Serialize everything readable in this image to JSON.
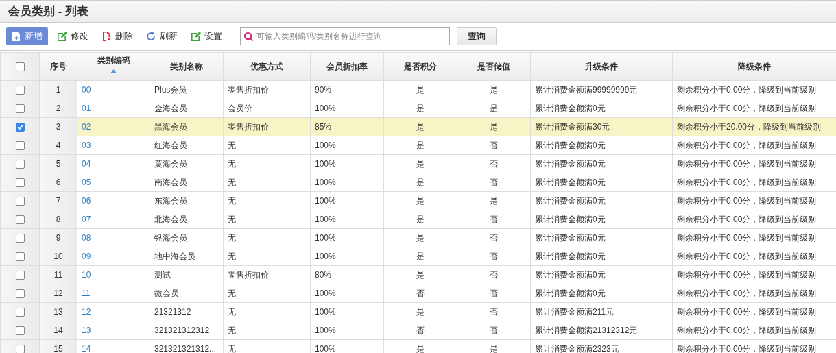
{
  "window": {
    "title": "会员类别 - 列表"
  },
  "toolbar": [
    {
      "label": "新增",
      "kind": "add",
      "primary": true
    },
    {
      "label": "修改",
      "kind": "edit",
      "primary": false
    },
    {
      "label": "删除",
      "kind": "delete",
      "primary": false
    },
    {
      "label": "刷新",
      "kind": "refresh",
      "primary": false
    },
    {
      "label": "设置",
      "kind": "edit",
      "primary": false
    }
  ],
  "search": {
    "placeholder": "可输入类别编码/类别名称进行查询",
    "button": "查询"
  },
  "table": {
    "select_all": {
      "checked": false
    },
    "columns": [
      {
        "label": "序号",
        "sorted": false
      },
      {
        "label": "类别编码",
        "sorted": true
      },
      {
        "label": "类别名称",
        "sorted": false
      },
      {
        "label": "优惠方式",
        "sorted": false
      },
      {
        "label": "会员折扣率",
        "sorted": false
      },
      {
        "label": "是否积分",
        "sorted": false
      },
      {
        "label": "是否储值",
        "sorted": false
      },
      {
        "label": "升级条件",
        "sorted": false
      },
      {
        "label": "降级条件",
        "sorted": false
      }
    ],
    "rows": [
      {
        "selected": false,
        "cells": [
          "1",
          "00",
          "Plus会员",
          "零售折扣价",
          "90%",
          "是",
          "是",
          "累计消费金额满99999999元",
          "剩余积分小于0.00分，降级到当前级别"
        ]
      },
      {
        "selected": false,
        "cells": [
          "2",
          "01",
          "金海会员",
          "会员价",
          "100%",
          "是",
          "是",
          "累计消费金额满0元",
          "剩余积分小于0.00分，降级到当前级别"
        ]
      },
      {
        "selected": true,
        "cells": [
          "3",
          "02",
          "黑海会员",
          "零售折扣价",
          "85%",
          "是",
          "是",
          "累计消费金额满30元",
          "剩余积分小于20.00分，降级到当前级别"
        ]
      },
      {
        "selected": false,
        "cells": [
          "4",
          "03",
          "红海会员",
          "无",
          "100%",
          "是",
          "否",
          "累计消费金额满0元",
          "剩余积分小于0.00分，降级到当前级别"
        ]
      },
      {
        "selected": false,
        "cells": [
          "5",
          "04",
          "黄海会员",
          "无",
          "100%",
          "是",
          "否",
          "累计消费金额满0元",
          "剩余积分小于0.00分，降级到当前级别"
        ]
      },
      {
        "selected": false,
        "cells": [
          "6",
          "05",
          "南海会员",
          "无",
          "100%",
          "是",
          "否",
          "累计消费金额满0元",
          "剩余积分小于0.00分，降级到当前级别"
        ]
      },
      {
        "selected": false,
        "cells": [
          "7",
          "06",
          "东海会员",
          "无",
          "100%",
          "是",
          "是",
          "累计消费金额满0元",
          "剩余积分小于0.00分，降级到当前级别"
        ]
      },
      {
        "selected": false,
        "cells": [
          "8",
          "07",
          "北海会员",
          "无",
          "100%",
          "是",
          "否",
          "累计消费金额满0元",
          "剩余积分小于0.00分，降级到当前级别"
        ]
      },
      {
        "selected": false,
        "cells": [
          "9",
          "08",
          "银海会员",
          "无",
          "100%",
          "是",
          "否",
          "累计消费金额满0元",
          "剩余积分小于0.00分，降级到当前级别"
        ]
      },
      {
        "selected": false,
        "cells": [
          "10",
          "09",
          "地中海会员",
          "无",
          "100%",
          "是",
          "否",
          "累计消费金额满0元",
          "剩余积分小于0.00分，降级到当前级别"
        ]
      },
      {
        "selected": false,
        "cells": [
          "11",
          "10",
          "测试",
          "零售折扣价",
          "80%",
          "是",
          "否",
          "累计消费金额满0元",
          "剩余积分小于0.00分，降级到当前级别"
        ]
      },
      {
        "selected": false,
        "cells": [
          "12",
          "11",
          "微会员",
          "无",
          "100%",
          "否",
          "否",
          "累计消费金额满0元",
          "剩余积分小于0.00分，降级到当前级别"
        ]
      },
      {
        "selected": false,
        "cells": [
          "13",
          "12",
          "21321312",
          "无",
          "100%",
          "是",
          "否",
          "累计消费金额满211元",
          "剩余积分小于0.00分，降级到当前级别"
        ]
      },
      {
        "selected": false,
        "cells": [
          "14",
          "13",
          "321321312312",
          "无",
          "100%",
          "否",
          "否",
          "累计消费金额满21312312元",
          "剩余积分小于0.00分，降级到当前级别"
        ]
      },
      {
        "selected": false,
        "cells": [
          "15",
          "14",
          "321321321312...",
          "无",
          "100%",
          "是",
          "是",
          "累计消费金额满2323元",
          "剩余积分小于0.00分，降级到当前级别"
        ]
      }
    ]
  }
}
